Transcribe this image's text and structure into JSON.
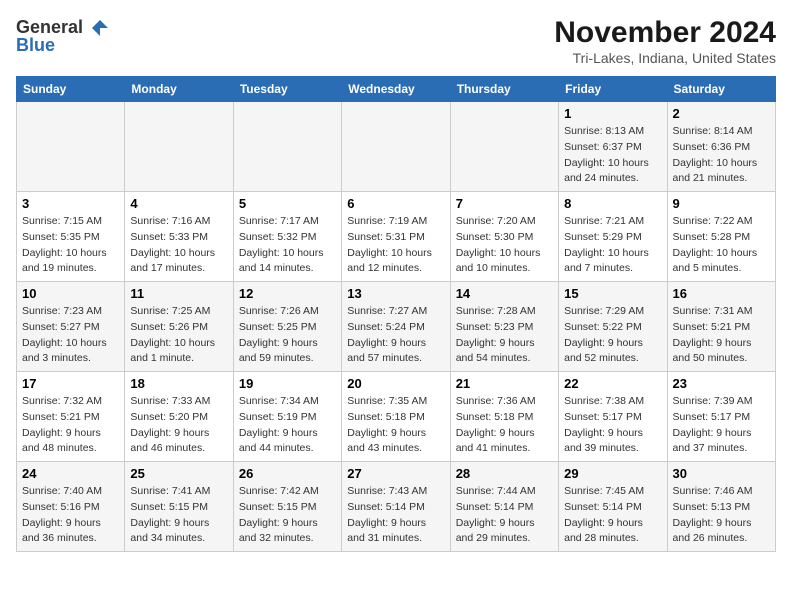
{
  "header": {
    "logo_general": "General",
    "logo_blue": "Blue",
    "month_title": "November 2024",
    "location": "Tri-Lakes, Indiana, United States"
  },
  "weekdays": [
    "Sunday",
    "Monday",
    "Tuesday",
    "Wednesday",
    "Thursday",
    "Friday",
    "Saturday"
  ],
  "weeks": [
    [
      {
        "day": "",
        "info": ""
      },
      {
        "day": "",
        "info": ""
      },
      {
        "day": "",
        "info": ""
      },
      {
        "day": "",
        "info": ""
      },
      {
        "day": "",
        "info": ""
      },
      {
        "day": "1",
        "info": "Sunrise: 8:13 AM\nSunset: 6:37 PM\nDaylight: 10 hours\nand 24 minutes."
      },
      {
        "day": "2",
        "info": "Sunrise: 8:14 AM\nSunset: 6:36 PM\nDaylight: 10 hours\nand 21 minutes."
      }
    ],
    [
      {
        "day": "3",
        "info": "Sunrise: 7:15 AM\nSunset: 5:35 PM\nDaylight: 10 hours\nand 19 minutes."
      },
      {
        "day": "4",
        "info": "Sunrise: 7:16 AM\nSunset: 5:33 PM\nDaylight: 10 hours\nand 17 minutes."
      },
      {
        "day": "5",
        "info": "Sunrise: 7:17 AM\nSunset: 5:32 PM\nDaylight: 10 hours\nand 14 minutes."
      },
      {
        "day": "6",
        "info": "Sunrise: 7:19 AM\nSunset: 5:31 PM\nDaylight: 10 hours\nand 12 minutes."
      },
      {
        "day": "7",
        "info": "Sunrise: 7:20 AM\nSunset: 5:30 PM\nDaylight: 10 hours\nand 10 minutes."
      },
      {
        "day": "8",
        "info": "Sunrise: 7:21 AM\nSunset: 5:29 PM\nDaylight: 10 hours\nand 7 minutes."
      },
      {
        "day": "9",
        "info": "Sunrise: 7:22 AM\nSunset: 5:28 PM\nDaylight: 10 hours\nand 5 minutes."
      }
    ],
    [
      {
        "day": "10",
        "info": "Sunrise: 7:23 AM\nSunset: 5:27 PM\nDaylight: 10 hours\nand 3 minutes."
      },
      {
        "day": "11",
        "info": "Sunrise: 7:25 AM\nSunset: 5:26 PM\nDaylight: 10 hours\nand 1 minute."
      },
      {
        "day": "12",
        "info": "Sunrise: 7:26 AM\nSunset: 5:25 PM\nDaylight: 9 hours\nand 59 minutes."
      },
      {
        "day": "13",
        "info": "Sunrise: 7:27 AM\nSunset: 5:24 PM\nDaylight: 9 hours\nand 57 minutes."
      },
      {
        "day": "14",
        "info": "Sunrise: 7:28 AM\nSunset: 5:23 PM\nDaylight: 9 hours\nand 54 minutes."
      },
      {
        "day": "15",
        "info": "Sunrise: 7:29 AM\nSunset: 5:22 PM\nDaylight: 9 hours\nand 52 minutes."
      },
      {
        "day": "16",
        "info": "Sunrise: 7:31 AM\nSunset: 5:21 PM\nDaylight: 9 hours\nand 50 minutes."
      }
    ],
    [
      {
        "day": "17",
        "info": "Sunrise: 7:32 AM\nSunset: 5:21 PM\nDaylight: 9 hours\nand 48 minutes."
      },
      {
        "day": "18",
        "info": "Sunrise: 7:33 AM\nSunset: 5:20 PM\nDaylight: 9 hours\nand 46 minutes."
      },
      {
        "day": "19",
        "info": "Sunrise: 7:34 AM\nSunset: 5:19 PM\nDaylight: 9 hours\nand 44 minutes."
      },
      {
        "day": "20",
        "info": "Sunrise: 7:35 AM\nSunset: 5:18 PM\nDaylight: 9 hours\nand 43 minutes."
      },
      {
        "day": "21",
        "info": "Sunrise: 7:36 AM\nSunset: 5:18 PM\nDaylight: 9 hours\nand 41 minutes."
      },
      {
        "day": "22",
        "info": "Sunrise: 7:38 AM\nSunset: 5:17 PM\nDaylight: 9 hours\nand 39 minutes."
      },
      {
        "day": "23",
        "info": "Sunrise: 7:39 AM\nSunset: 5:17 PM\nDaylight: 9 hours\nand 37 minutes."
      }
    ],
    [
      {
        "day": "24",
        "info": "Sunrise: 7:40 AM\nSunset: 5:16 PM\nDaylight: 9 hours\nand 36 minutes."
      },
      {
        "day": "25",
        "info": "Sunrise: 7:41 AM\nSunset: 5:15 PM\nDaylight: 9 hours\nand 34 minutes."
      },
      {
        "day": "26",
        "info": "Sunrise: 7:42 AM\nSunset: 5:15 PM\nDaylight: 9 hours\nand 32 minutes."
      },
      {
        "day": "27",
        "info": "Sunrise: 7:43 AM\nSunset: 5:14 PM\nDaylight: 9 hours\nand 31 minutes."
      },
      {
        "day": "28",
        "info": "Sunrise: 7:44 AM\nSunset: 5:14 PM\nDaylight: 9 hours\nand 29 minutes."
      },
      {
        "day": "29",
        "info": "Sunrise: 7:45 AM\nSunset: 5:14 PM\nDaylight: 9 hours\nand 28 minutes."
      },
      {
        "day": "30",
        "info": "Sunrise: 7:46 AM\nSunset: 5:13 PM\nDaylight: 9 hours\nand 26 minutes."
      }
    ]
  ]
}
